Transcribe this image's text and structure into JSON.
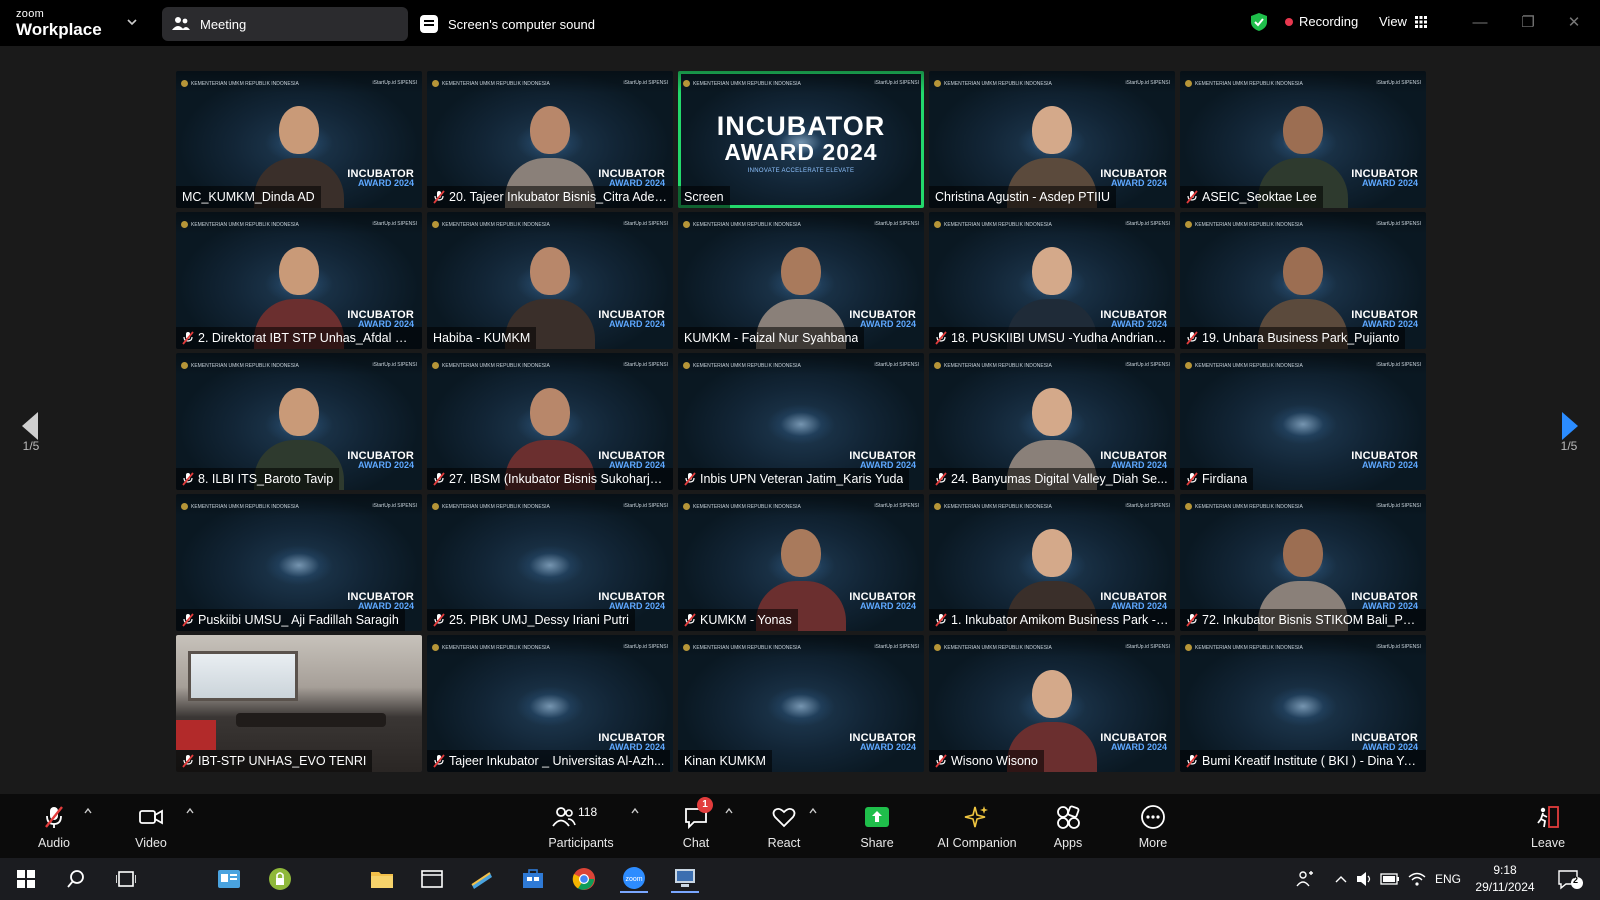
{
  "app": {
    "brand_small": "zoom",
    "brand_big": "Workplace",
    "meeting_tab": "Meeting",
    "sound_tab": "Screen's computer sound",
    "recording_label": "Recording",
    "view_label": "View"
  },
  "colors": {
    "active_speaker_border": "#23d96b",
    "recording_dot": "#e8384f",
    "share_green": "#1fbf4b",
    "accent_blue": "#2b8cff",
    "muted_red": "#e23c3c"
  },
  "gallery": {
    "page_left": "1/5",
    "page_right": "1/5",
    "watermark_top": "INCUBATOR",
    "watermark_bottom": "AWARD 2024",
    "screen_title_1": "INCUBATOR",
    "screen_title_2": "AWARD 2024",
    "screen_tagline": "INNOVATE ACCELERATE ELEVATE",
    "tile_header_left": "KEMENTERIAN UMKM REPUBLIK INDONESIA",
    "tile_header_right": "iStartUp.id SIPENSI",
    "tiles": [
      {
        "name": "MC_KUMKM_Dinda AD",
        "muted": false,
        "type": "person"
      },
      {
        "name": "20. Tajeer Inkubator Bisnis_Citra Ade ...",
        "muted": true,
        "type": "person"
      },
      {
        "name": "Screen",
        "muted": false,
        "type": "screen",
        "active": true
      },
      {
        "name": "Christina Agustin - Asdep PTIIU",
        "muted": false,
        "type": "person"
      },
      {
        "name": "ASEIC_Seoktae Lee",
        "muted": true,
        "type": "person"
      },
      {
        "name": "2. Direktorat IBT STP Unhas_Afdal Ma...",
        "muted": true,
        "type": "person"
      },
      {
        "name": "Habiba - KUMKM",
        "muted": false,
        "type": "person"
      },
      {
        "name": "KUMKM - Faizal Nur Syahbana",
        "muted": false,
        "type": "person"
      },
      {
        "name": "18. PUSKIIBI UMSU -Yudha Andrians...",
        "muted": true,
        "type": "person"
      },
      {
        "name": "19. Unbara Business Park_Pujianto",
        "muted": true,
        "type": "person"
      },
      {
        "name": "8. ILBI ITS_Baroto Tavip",
        "muted": true,
        "type": "person"
      },
      {
        "name": "27. IBSM (Inkubator Bisnis Sukoharjo...",
        "muted": true,
        "type": "person"
      },
      {
        "name": "Inbis UPN Veteran Jatim_Karis Yuda",
        "muted": true,
        "type": "background"
      },
      {
        "name": "24. Banyumas Digital Valley_Diah Se...",
        "muted": true,
        "type": "person"
      },
      {
        "name": "Firdiana",
        "muted": true,
        "type": "background"
      },
      {
        "name": "Puskiibi UMSU_ Aji Fadillah Saragih",
        "muted": true,
        "type": "background"
      },
      {
        "name": "25. PIBK UMJ_Dessy Iriani Putri",
        "muted": true,
        "type": "background"
      },
      {
        "name": "KUMKM - Yonas",
        "muted": true,
        "type": "person"
      },
      {
        "name": "1. Inkubator Amikom Business Park - ...",
        "muted": true,
        "type": "person"
      },
      {
        "name": "72. Inkubator Bisnis STIKOM Bali_Put...",
        "muted": true,
        "type": "person"
      },
      {
        "name": "IBT-STP UNHAS_EVO TENRI",
        "muted": true,
        "type": "room"
      },
      {
        "name": "Tajeer Inkubator _ Universitas Al-Azh...",
        "muted": true,
        "type": "background"
      },
      {
        "name": "Kinan KUMKM",
        "muted": false,
        "type": "background"
      },
      {
        "name": "Wisono Wisono",
        "muted": true,
        "type": "person"
      },
      {
        "name": "Bumi Kreatif Institute ( BKI ) - Dina Yo...",
        "muted": true,
        "type": "background"
      }
    ]
  },
  "toolbar": {
    "audio": "Audio",
    "video": "Video",
    "participants": "Participants",
    "participants_count": "118",
    "chat": "Chat",
    "chat_badge": "1",
    "react": "React",
    "share": "Share",
    "ai_companion": "AI Companion",
    "apps": "Apps",
    "more": "More",
    "leave": "Leave"
  },
  "taskbar": {
    "language": "ENG",
    "time": "9:18",
    "date": "29/11/2024",
    "notification_count": "2"
  }
}
